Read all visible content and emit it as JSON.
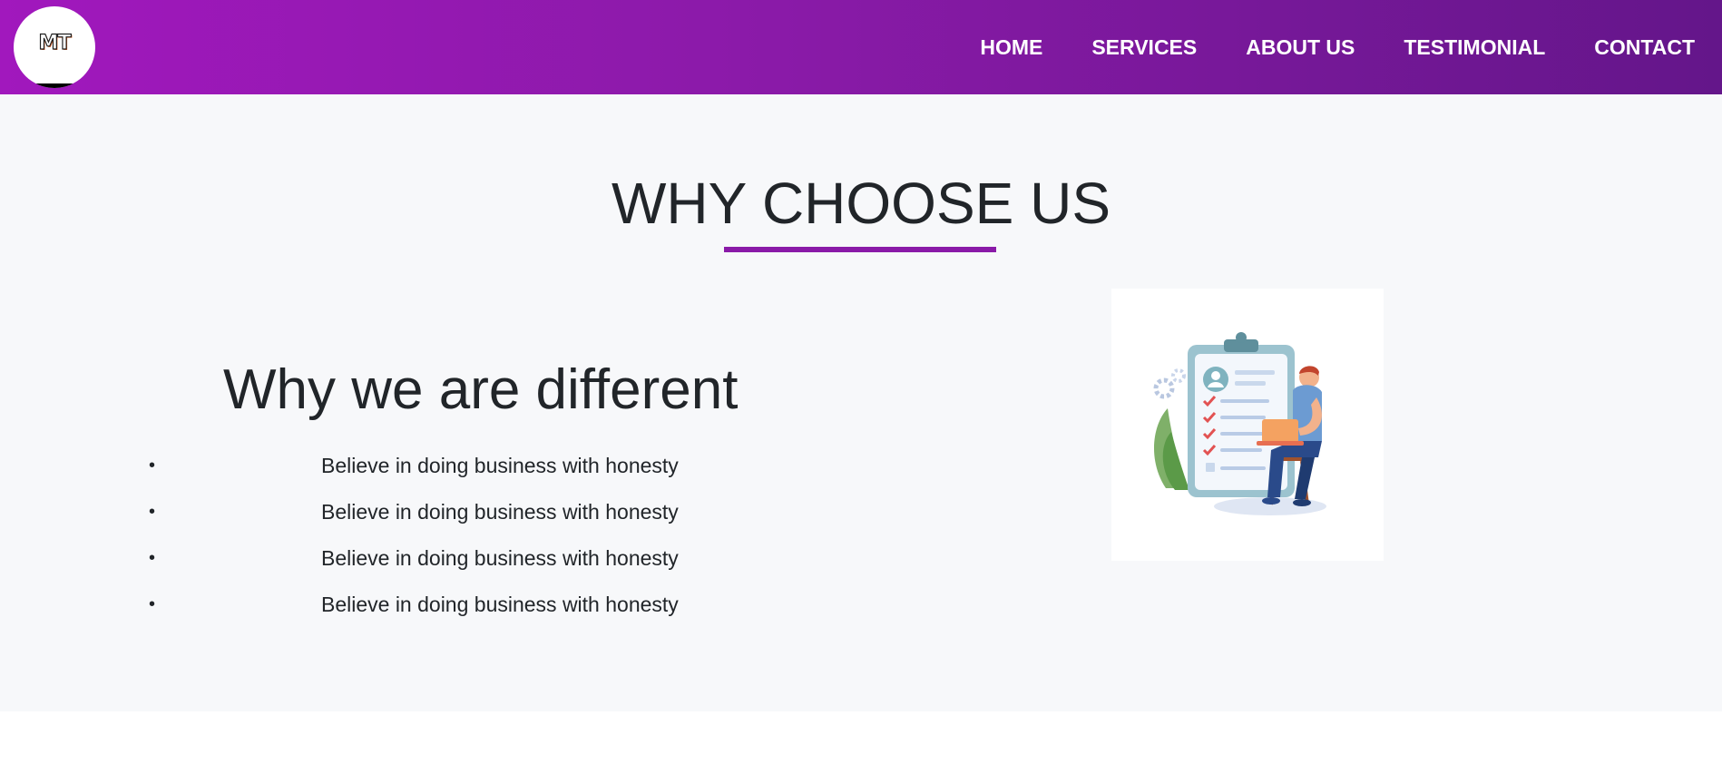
{
  "header": {
    "logo_text": "MT",
    "nav": {
      "home": "HOME",
      "services": "SERVICES",
      "about": "ABOUT US",
      "testimonial": "TESTIMONIAL",
      "contact": "CONTACT"
    }
  },
  "why_choose": {
    "title": "WHY CHOOSE US",
    "subtitle": "Why we are different",
    "items": [
      "Believe in doing business with honesty",
      "Believe in doing business with honesty",
      "Believe in doing business with honesty",
      "Believe in doing business with honesty"
    ],
    "bullet": "•"
  },
  "colors": {
    "accent": "#8a1aa8",
    "header_gradient_start": "#a118bd",
    "header_gradient_end": "#64168a",
    "section_bg": "#f7f8fa"
  },
  "icons": {
    "illustration": "checklist-illustration"
  }
}
